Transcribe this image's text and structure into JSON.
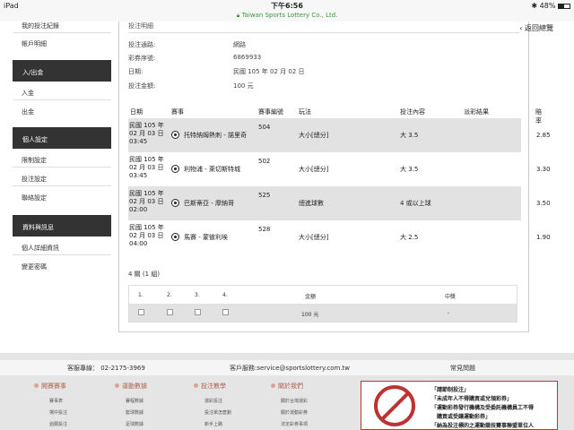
{
  "statusbar": {
    "device": "iPad",
    "time": "下午6:56",
    "battery": "48%"
  },
  "urlbar": {
    "site": "Taiwan Sports Lottery Co., Ltd."
  },
  "sidebar": {
    "links_top": [
      "我的投注紀錄",
      "帳戶明細"
    ],
    "group1": {
      "title": "入/出金",
      "items": [
        "入金",
        "出金"
      ]
    },
    "group2": {
      "title": "個人設定",
      "items": [
        "限制設定",
        "投注設定",
        "聯絡設定"
      ]
    },
    "group3": {
      "title": "資料與訊息",
      "items": [
        "個人詳細資訊",
        "變更密碼"
      ]
    }
  },
  "main": {
    "breadcrumb": "投注明細",
    "back_label": "返回總覽",
    "info": [
      {
        "label": "投注通路:",
        "value": "網路"
      },
      {
        "label": "彩券序號:",
        "value": "6869933"
      },
      {
        "label": "日期:",
        "value": "民國 105 年 02 月 02 日"
      },
      {
        "label": "投注金額:",
        "value": "100 元"
      }
    ],
    "headers": [
      "日期",
      "賽事",
      "賽事編號",
      "玩法",
      "投注內容",
      "派彩結果",
      "賠率"
    ],
    "rows": [
      {
        "d1": "民國 105 年",
        "d2": "02 月 03 日",
        "d3": "03:45",
        "match": "托特納姆熱刺 - 諾里奇",
        "id": "504",
        "play": "大小[總分]",
        "bet": "大 3.5",
        "result": "",
        "odds": "2.85"
      },
      {
        "d1": "民國 105 年",
        "d2": "02 月 03 日",
        "d3": "03:45",
        "match": "利物浦 - 萊切斯特城",
        "id": "502",
        "play": "大小[總分]",
        "bet": "大 3.5",
        "result": "",
        "odds": "3.30"
      },
      {
        "d1": "民國 105 年",
        "d2": "02 月 03 日",
        "d3": "02:00",
        "match": "巴斯蒂亞 - 摩納哥",
        "id": "525",
        "play": "總進球數",
        "bet": "4 或以上球",
        "result": "",
        "odds": "3.50"
      },
      {
        "d1": "民國 105 年",
        "d2": "02 月 03 日",
        "d3": "04:00",
        "match": "馬賽 - 蒙彼利埃",
        "id": "528",
        "play": "大小[總分]",
        "bet": "大 2.5",
        "result": "",
        "odds": "1.90"
      }
    ],
    "summary": "4 關 (1 組)",
    "combo": {
      "cols": [
        "1.",
        "2.",
        "3.",
        "4."
      ],
      "amount_label": "金額",
      "win_label": "中獎",
      "amount_value": "100 元",
      "win_value": "-"
    }
  },
  "footer": {
    "phone": "客服專線： 02-2175-3969",
    "email": "客戶服務:service@sportslottery.com.tw",
    "faq": "常見問題",
    "columns": [
      {
        "title": "開賽賽事",
        "items": [
          "賽事表",
          "場中投注",
          "過關投注"
        ]
      },
      {
        "title": "運動數據",
        "items": [
          "賽程數據",
          "籃球數據",
          "足球數據"
        ]
      },
      {
        "title": "投注教學",
        "items": [
          "運彩投注",
          "投注單怎麼劃",
          "新手上路"
        ]
      },
      {
        "title": "關於我們",
        "items": [
          "關於台灣運彩",
          "關於運動彩券",
          "法定彩券事項"
        ]
      }
    ],
    "warning": [
      "「請節制投注」",
      "「未成年人不得購買或兌領彩券」",
      "「運動彩券發行機構及受委託機構員工不得",
      "購買或受讓運動彩券」",
      "「納為投注標的之運動競技賽事聯盟單位人"
    ]
  }
}
